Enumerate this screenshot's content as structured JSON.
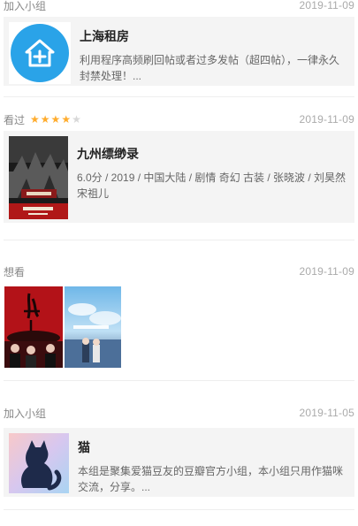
{
  "feed": [
    {
      "kind": "group",
      "action": "加入小组",
      "date": "2019-11-09",
      "title": "上海租房",
      "desc": "利用程序高频刷回帖或者过多发帖（超四帖），一律永久封禁处理！...",
      "icon": "house-plus-icon",
      "accent": "#2aa3e8"
    },
    {
      "kind": "movie",
      "action": "看过",
      "rating": 4,
      "rating_max": 5,
      "date": "2019-11-09",
      "title": "九州缥缈录",
      "desc": "6.0分 / 2019 / 中国大陆 / 剧情 奇幻 古装 / 张晓波 / 刘昊然 宋祖儿"
    },
    {
      "kind": "wish",
      "action": "想看",
      "date": "2019-11-09",
      "posters": [
        "poster-red-drama",
        "poster-anime-sky"
      ]
    },
    {
      "kind": "group",
      "action": "加入小组",
      "date": "2019-11-05",
      "title": "猫",
      "desc": "本组是聚集爱猫豆友的豆瓣官方小组，本小组只用作猫咪交流，分享。...",
      "icon": "cat-silhouette-icon"
    }
  ],
  "colors": {
    "star_on": "#ffac2d",
    "star_off": "#d8d8d8",
    "card_bg": "#f4f4f4"
  }
}
